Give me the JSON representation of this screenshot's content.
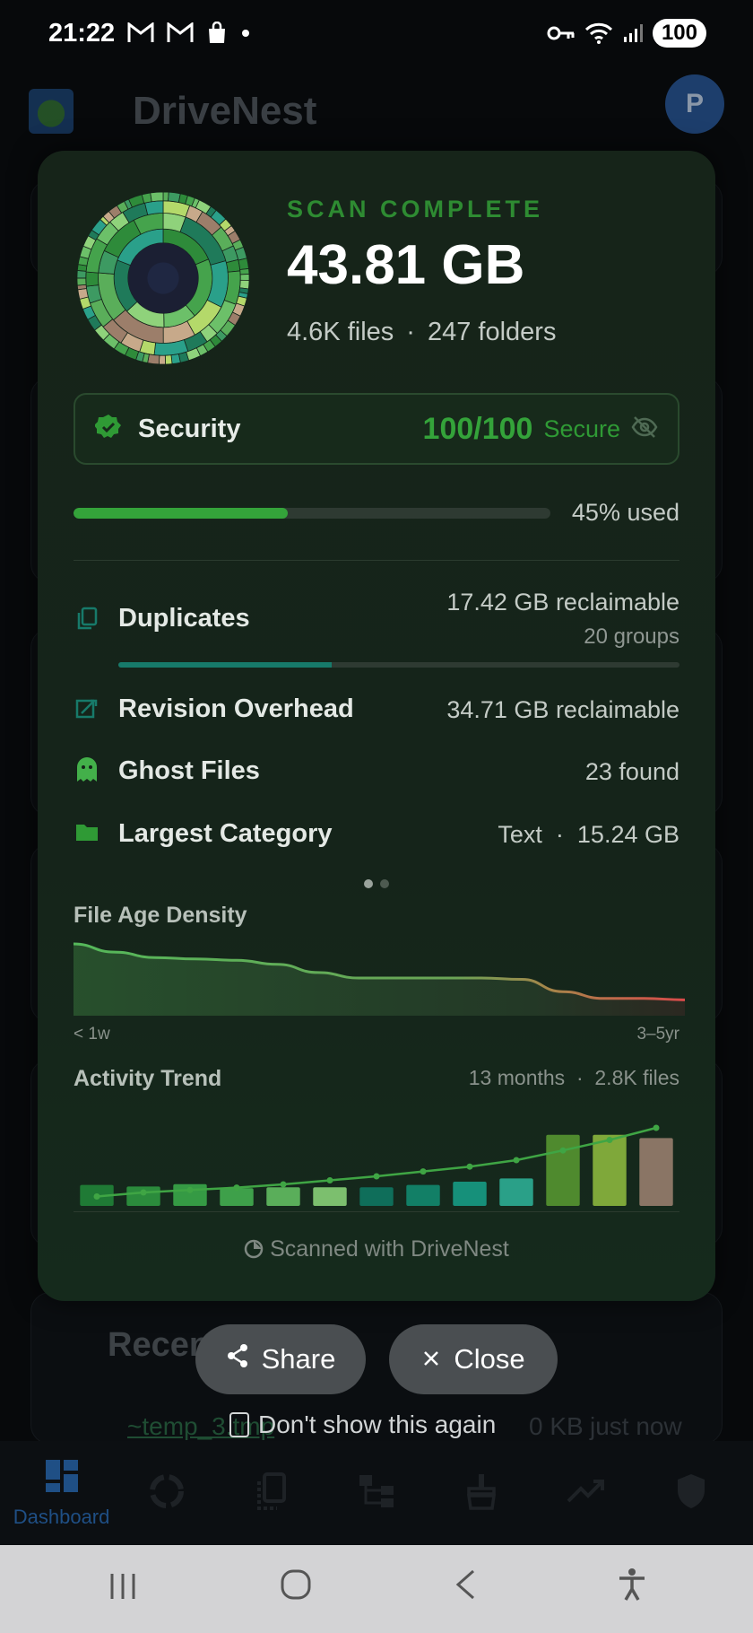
{
  "status_bar": {
    "time": "21:22",
    "icons": [
      "gmail-icon",
      "gmail-icon",
      "shopping-bag-icon",
      "dot-icon"
    ],
    "right_icons": [
      "key-icon",
      "wifi-icon",
      "signal-icon"
    ],
    "battery": "100"
  },
  "app": {
    "title": "DriveNest",
    "avatar_letter": "P"
  },
  "scan": {
    "label": "SCAN COMPLETE",
    "total_size": "43.81 GB",
    "files": "4.6K files",
    "separator": "·",
    "folders": "247 folders"
  },
  "security": {
    "title": "Security",
    "score": "100/100",
    "status": "Secure",
    "icon": "verified-badge-icon",
    "toggle_icon": "eye-off-icon"
  },
  "usage": {
    "percent_used": 45,
    "label": "45% used"
  },
  "stats": {
    "duplicates": {
      "title": "Duplicates",
      "value": "17.42 GB reclaimable",
      "sub": "20 groups",
      "bar_fraction": 0.38
    },
    "revision": {
      "title": "Revision Overhead",
      "value": "34.71 GB reclaimable"
    },
    "ghost": {
      "title": "Ghost Files",
      "value": "23 found"
    },
    "largest": {
      "title": "Largest Category",
      "value": "Text  ·  15.24 GB"
    }
  },
  "pager": {
    "count": 2,
    "active": 0
  },
  "file_age_density": {
    "title": "File Age Density",
    "axis_start": "< 1w",
    "axis_end": "3–5yr",
    "chart_data": {
      "type": "area",
      "values": [
        1.0,
        0.88,
        0.8,
        0.78,
        0.76,
        0.7,
        0.58,
        0.5,
        0.5,
        0.5,
        0.5,
        0.48,
        0.3,
        0.2,
        0.2,
        0.18
      ],
      "ylim": [
        0,
        1
      ]
    }
  },
  "activity_trend": {
    "title": "Activity Trend",
    "meta": "13 months  ·  2.8K files",
    "chart_data": {
      "type": "bar",
      "values": [
        0.26,
        0.24,
        0.27,
        0.22,
        0.23,
        0.23,
        0.23,
        0.26,
        0.3,
        0.34,
        0.88,
        0.88,
        0.84
      ],
      "line": [
        0.05,
        0.1,
        0.13,
        0.16,
        0.2,
        0.25,
        0.3,
        0.36,
        0.42,
        0.5,
        0.62,
        0.75,
        0.9
      ],
      "colors": [
        "#1f7a35",
        "#2b8b3c",
        "#359a44",
        "#3ea04a",
        "#5aae5a",
        "#7cbf6e",
        "#0f6e5a",
        "#127f66",
        "#16907a",
        "#2aa088",
        "#4f8a2e",
        "#7fa83a",
        "#8a7565"
      ],
      "ylim": [
        0,
        1
      ]
    }
  },
  "footer": {
    "text": "Scanned with DriveNest"
  },
  "actions": {
    "share_label": "Share",
    "close_label": "Close",
    "dont_show_label": "Don't show this again"
  },
  "recent": {
    "title": "Recent Files",
    "item_name": "~temp_3.tmp",
    "item_size": "0 KB",
    "item_time": "just now"
  },
  "bottom_nav": {
    "items": [
      {
        "label": "Dashboard",
        "icon": "dashboard-icon",
        "active": true
      },
      {
        "label": "",
        "icon": "scan-ring-icon"
      },
      {
        "label": "",
        "icon": "duplicates-icon"
      },
      {
        "label": "",
        "icon": "tree-icon"
      },
      {
        "label": "",
        "icon": "broom-icon"
      },
      {
        "label": "",
        "icon": "trend-icon"
      },
      {
        "label": "",
        "icon": "shield-icon"
      }
    ]
  }
}
